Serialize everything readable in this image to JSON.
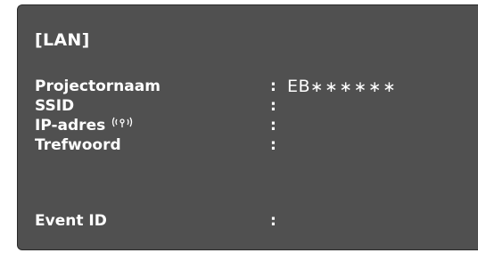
{
  "header": {
    "title": "[LAN]"
  },
  "rows": [
    {
      "label": "Projectornaam",
      "colon": ":",
      "value_prefix": "EB",
      "value_mask": "******"
    },
    {
      "label": "SSID",
      "colon": ":"
    },
    {
      "label": "IP-adres",
      "colon": ":",
      "icon": "wireless-signal-icon"
    },
    {
      "label": "Trefwoord",
      "colon": ":"
    },
    {
      "label": "Event ID",
      "colon": ":"
    }
  ],
  "colors": {
    "background": "#505050",
    "text": "#ffffff"
  }
}
